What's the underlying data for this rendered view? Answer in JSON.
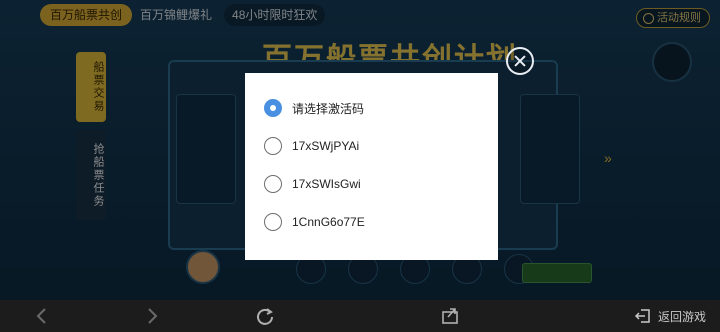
{
  "background": {
    "tabs": [
      "百万船票共创",
      "百万锦鲤爆礼",
      "48小时限时狂欢"
    ],
    "rules_label": "活动规则",
    "banner_title": "百万船票共创计划",
    "side_tabs": [
      "船票交易",
      "抢船票任务"
    ]
  },
  "dialog": {
    "options": [
      {
        "label": "请选择激活码",
        "checked": true
      },
      {
        "label": "17xSWjPYAi",
        "checked": false
      },
      {
        "label": "17xSWIsGwi",
        "checked": false
      },
      {
        "label": "1CnnG6o77E",
        "checked": false
      }
    ],
    "accent_color": "#4a90e2"
  },
  "navbar": {
    "back_to_game_label": "返回游戏"
  }
}
